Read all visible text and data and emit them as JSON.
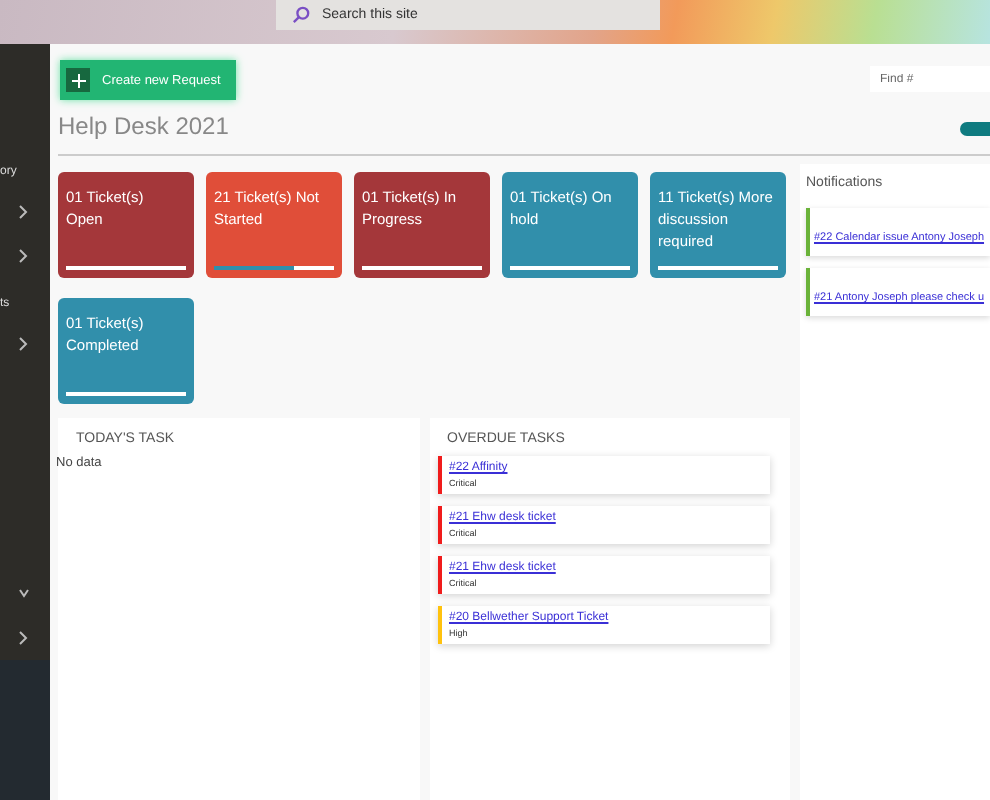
{
  "top_bar": {
    "search": {
      "placeholder": "Search this site"
    }
  },
  "sidebar": {
    "items": [
      {
        "kind": "heading",
        "label": "ory"
      },
      {
        "kind": "expander",
        "expanded": false
      },
      {
        "kind": "expander",
        "expanded": false
      },
      {
        "kind": "heading",
        "label": "ts"
      },
      {
        "kind": "expander",
        "expanded": false
      },
      {
        "kind": "expander",
        "expanded": true
      },
      {
        "kind": "expander",
        "expanded": false
      }
    ]
  },
  "create_button": {
    "label": "Create new Request"
  },
  "find": {
    "placeholder": "Find #"
  },
  "title": "Help Desk 2021",
  "toggle": {
    "on": true
  },
  "tiles": [
    {
      "label": "01 Ticket(s) Open",
      "color": "#a4373a",
      "level": 0
    },
    {
      "label": "21 Ticket(s) Not Started",
      "color": "#e04e39",
      "level": 0.66
    },
    {
      "label": "01 Ticket(s) In Progress",
      "color": "#a4373a",
      "level": 0
    },
    {
      "label": "01 Ticket(s) On hold",
      "color": "#318fab",
      "level": 0
    },
    {
      "label": "11 Ticket(s) More discussion required",
      "color": "#318fab",
      "level": 0
    },
    {
      "label": "01 Ticket(s) Completed",
      "color": "#318fab",
      "level": 0
    }
  ],
  "todays_task": {
    "heading": "TODAY'S TASK",
    "empty_text": "No data"
  },
  "overdue_tasks": {
    "heading": "OVERDUE TASKS",
    "items": [
      {
        "title": "#22 Affinity",
        "priority": "Critical",
        "color": "#f01c1c"
      },
      {
        "title": "#21 Ehw desk ticket",
        "priority": "Critical",
        "color": "#f01c1c"
      },
      {
        "title": "#21 Ehw desk ticket",
        "priority": "Critical",
        "color": "#f01c1c"
      },
      {
        "title": "#20 Bellwether Support Ticket",
        "priority": "High",
        "color": "#ffc20e"
      }
    ]
  },
  "notifications": {
    "heading": "Notifications",
    "items": [
      {
        "text": "#22 Calendar issue Antony Joseph",
        "color": "#6bb33a"
      },
      {
        "text": "#21 Antony Joseph please check u",
        "color": "#6bb33a"
      }
    ]
  }
}
